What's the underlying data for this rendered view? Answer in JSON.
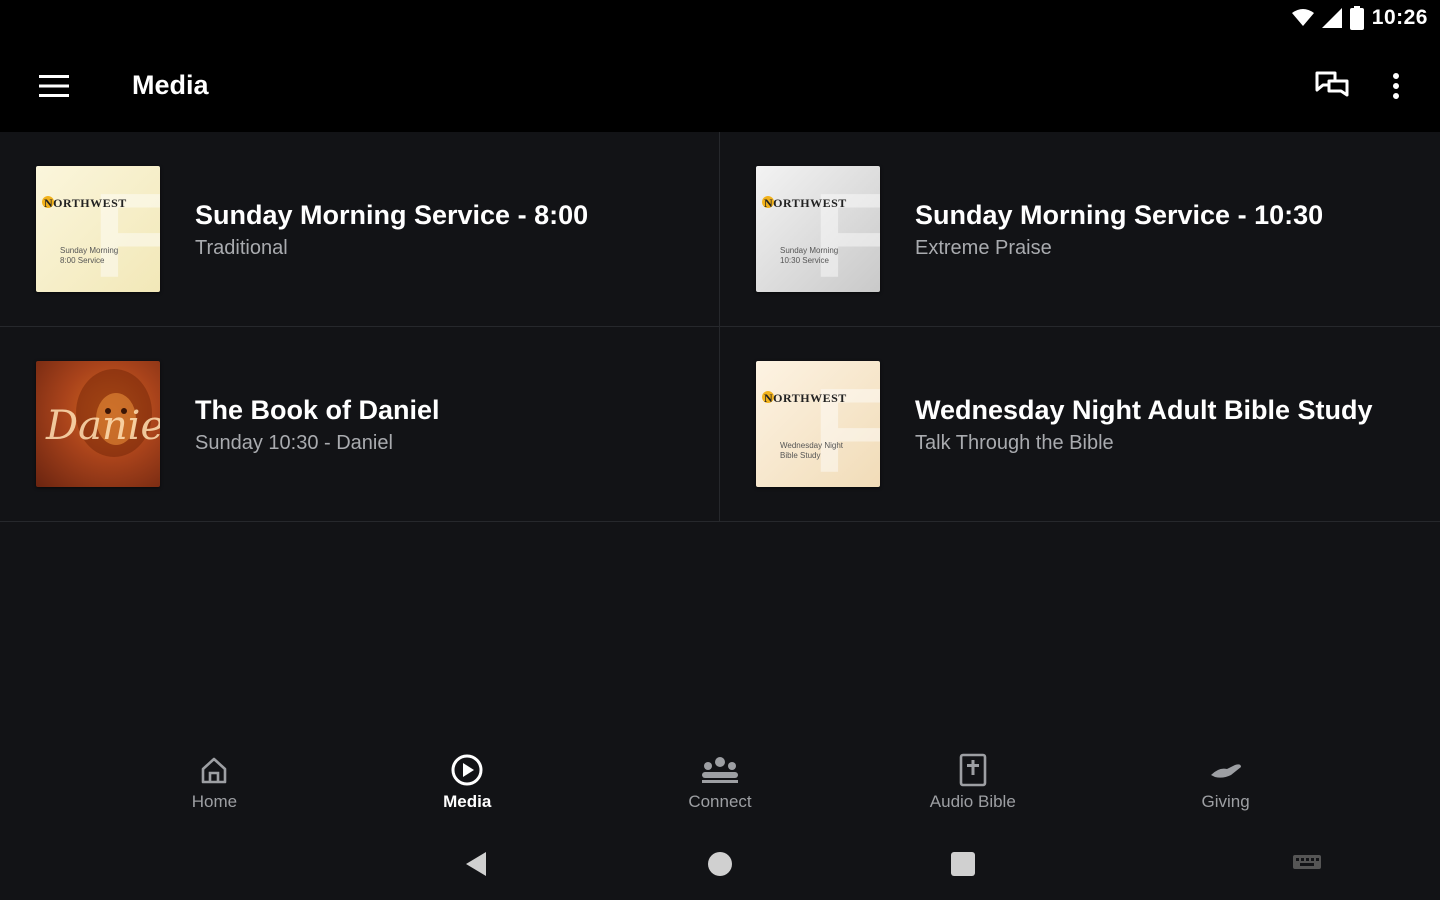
{
  "status_bar": {
    "time": "10:26",
    "icons": [
      "wifi-icon",
      "signal-icon",
      "battery-icon"
    ]
  },
  "app_bar": {
    "title": "Media",
    "icons": [
      "menu-icon",
      "chat-icon",
      "more-vert-icon"
    ]
  },
  "media_items": [
    {
      "title": "Sunday Morning Service - 8:00",
      "subtitle": "Traditional",
      "thumb": {
        "logo": "NORTHWEST",
        "line1": "Sunday Morning",
        "line2": "8:00 Service",
        "bg": "#f7efc9"
      }
    },
    {
      "title": "Sunday Morning Service - 10:30",
      "subtitle": "Extreme Praise",
      "thumb": {
        "logo": "NORTHWEST",
        "line1": "Sunday Morning",
        "line2": "10:30 Service",
        "bg": "#e5e5e5"
      }
    },
    {
      "title": "The Book of Daniel",
      "subtitle": "Sunday 10:30 - Daniel",
      "thumb": {
        "script": "Daniel"
      }
    },
    {
      "title": "Wednesday Night Adult Bible Study",
      "subtitle": "Talk Through the Bible",
      "thumb": {
        "logo": "NORTHWEST",
        "line1": "Wednesday Night",
        "line2": "Bible Study",
        "bg": "#f7e6cc"
      }
    }
  ],
  "bottom_nav": [
    {
      "label": "Home",
      "icon": "home-icon",
      "active": false
    },
    {
      "label": "Media",
      "icon": "play-circle-icon",
      "active": true
    },
    {
      "label": "Connect",
      "icon": "people-icon",
      "active": false
    },
    {
      "label": "Audio Bible",
      "icon": "bible-icon",
      "active": false
    },
    {
      "label": "Giving",
      "icon": "giving-hand-icon",
      "active": false
    }
  ],
  "system_nav": [
    "back-icon",
    "home-circle-icon",
    "recents-icon",
    "keyboard-icon"
  ],
  "colors": {
    "background": "#121316",
    "app_bar": "#000000",
    "divider": "#26282c",
    "subtitle": "#a9abaf",
    "nav_inactive": "#9d9fa3",
    "accent": "#f2b21b"
  }
}
